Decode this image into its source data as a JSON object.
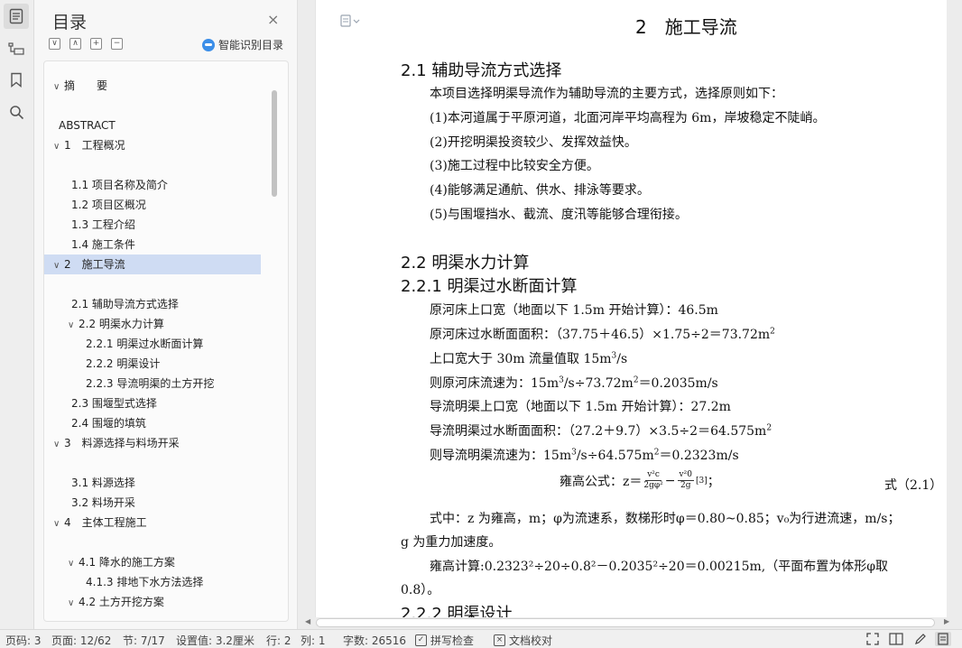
{
  "rail": {
    "icons": [
      "toc-icon",
      "outline-icon",
      "bookmark-icon",
      "search-icon"
    ]
  },
  "toc": {
    "title": "目录",
    "close": "×",
    "tools": [
      "∨",
      "∧",
      "+",
      "−"
    ],
    "smart_label": "智能识别目录",
    "items": [
      {
        "label": "摘　　要",
        "level": 1,
        "chevron": "∨",
        "selected": false
      },
      {
        "label": "ABSTRACT",
        "level": 1,
        "chevron": "",
        "selected": false
      },
      {
        "label": "1　工程概况",
        "level": 1,
        "chevron": "∨",
        "selected": false
      },
      {
        "label": "1.1 项目名称及简介",
        "level": 2,
        "chevron": "",
        "selected": false
      },
      {
        "label": "1.2 项目区概况",
        "level": 2,
        "chevron": "",
        "selected": false
      },
      {
        "label": "1.3 工程介绍",
        "level": 2,
        "chevron": "",
        "selected": false
      },
      {
        "label": "1.4 施工条件",
        "level": 2,
        "chevron": "",
        "selected": false
      },
      {
        "label": "2　施工导流",
        "level": 1,
        "chevron": "∨",
        "selected": true
      },
      {
        "label": "2.1 辅助导流方式选择",
        "level": 2,
        "chevron": "",
        "selected": false
      },
      {
        "label": "2.2 明渠水力计算",
        "level": 2,
        "chevron": "∨",
        "selected": false
      },
      {
        "label": "2.2.1 明渠过水断面计算",
        "level": 3,
        "chevron": "",
        "selected": false
      },
      {
        "label": "2.2.2 明渠设计",
        "level": 3,
        "chevron": "",
        "selected": false
      },
      {
        "label": "2.2.3 导流明渠的土方开挖",
        "level": 3,
        "chevron": "",
        "selected": false
      },
      {
        "label": "2.3 围堰型式选择",
        "level": 2,
        "chevron": "",
        "selected": false
      },
      {
        "label": "2.4 围堰的填筑",
        "level": 2,
        "chevron": "",
        "selected": false
      },
      {
        "label": "3　料源选择与料场开采",
        "level": 1,
        "chevron": "∨",
        "selected": false
      },
      {
        "label": "3.1 料源选择",
        "level": 2,
        "chevron": "",
        "selected": false
      },
      {
        "label": "3.2 料场开采",
        "level": 2,
        "chevron": "",
        "selected": false
      },
      {
        "label": "4　主体工程施工",
        "level": 1,
        "chevron": "∨",
        "selected": false
      },
      {
        "label": "4.1 降水的施工方案",
        "level": 2,
        "chevron": "∨",
        "selected": false
      },
      {
        "label": "4.1.3 排地下水方法选择",
        "level": 3,
        "chevron": "",
        "selected": false
      },
      {
        "label": "4.2 土方开挖方案",
        "level": 2,
        "chevron": "∨",
        "selected": false
      }
    ]
  },
  "doc": {
    "chapter_title": "2　施工导流",
    "s21_title": "2.1 辅助导流方式选择",
    "s21_intro": "本项目选择明渠导流作为辅助导流的主要方式，选择原则如下：",
    "s21_items": [
      "(1)本河道属于平原河道，北面河岸平均高程为 6m，岸坡稳定不陡峭。",
      "(2)开挖明渠投资较少、发挥效益快。",
      "(3)施工过程中比较安全方便。",
      "(4)能够满足通航、供水、排泳等要求。",
      "(5)与围堰挡水、截流、度汛等能够合理衔接。"
    ],
    "s22_title": "2.2 明渠水力计算",
    "s221_title": "2.2.1 明渠过水断面计算",
    "calc": {
      "l1": "原河床上口宽（地面以下 1.5m 开始计算）：46.5m",
      "l2_pre": "原河床过水断面面积：（37.75＋46.5）×1.75÷2＝73.72m",
      "l2_sup": "2",
      "l3_pre": "上口宽大于 30m 流量值取 15m",
      "l3_sup": "3",
      "l3_post": "/s",
      "l4_a": "则原河床流速为：15m",
      "l4_sup1": "3",
      "l4_b": "/s÷73.72m",
      "l4_sup2": "2",
      "l4_c": "＝0.2035m/s",
      "l5": "导流明渠上口宽（地面以下 1.5m 开始计算）：27.2m",
      "l6_pre": "导流明渠过水断面面积：（27.2＋9.7）×3.5÷2＝64.575m",
      "l6_sup": "2",
      "l7_a": "则导流明渠流速为：15m",
      "l7_sup1": "3",
      "l7_b": "/s÷64.575m",
      "l7_sup2": "2",
      "l7_c": "＝0.2323m/s"
    },
    "formula": {
      "label": "雍高公式：z＝",
      "f1_num": "v²c",
      "f1_den": "2gφ²",
      "minus": "−",
      "f2_num": "v²0",
      "f2_den": "2g",
      "ref": "[3]",
      "tail": "；",
      "tag": "式（2.1）"
    },
    "explain_1": "式中：z 为雍高，m；φ为流速系，数梯形时φ＝0.80~0.85；v₀为行进流速，m/s；",
    "explain_2": "g 为重力加速度。",
    "calc2_1": "雍高计算:0.2323²÷20÷0.8²－0.2035²÷20＝0.00215m,（平面布置为体形φ取",
    "calc2_2": "0.8）。",
    "s222_title": "2.2.2 明渠设计"
  },
  "status": {
    "page_code": "页码: 3",
    "page": "页面: 12/62",
    "section": "节: 7/17",
    "setting": "设置值: 3.2厘米",
    "row": "行: 2",
    "col": "列: 1",
    "words": "字数: 26516",
    "spell": "拼写检查",
    "proof": "文档校对"
  }
}
